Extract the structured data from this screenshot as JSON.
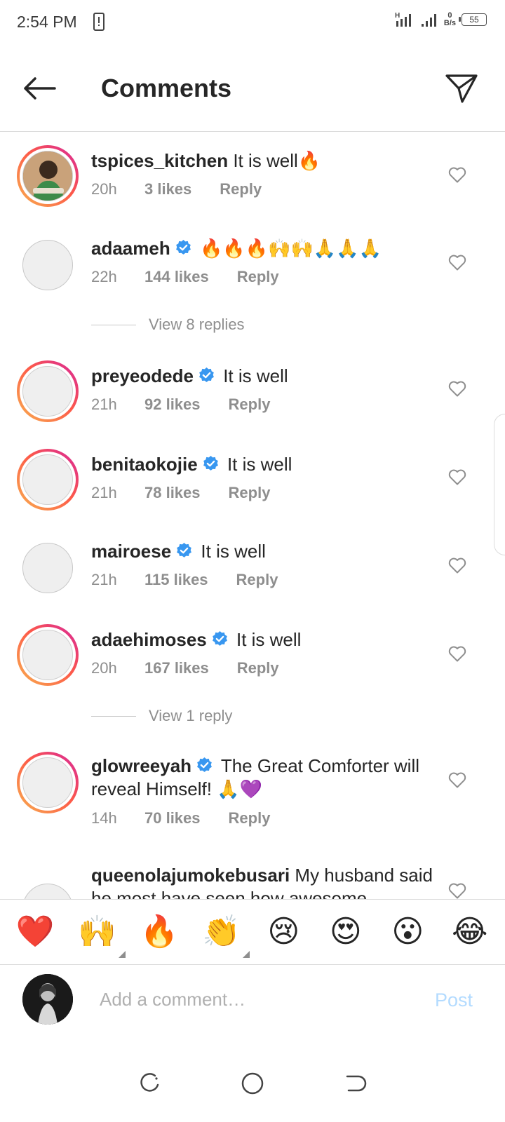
{
  "status_bar": {
    "time": "2:54 PM",
    "network_speed_value": "0",
    "network_speed_unit": "B/s",
    "battery": "55",
    "signal_label": "H"
  },
  "header": {
    "title": "Comments"
  },
  "comments": [
    {
      "username": "tspices_kitchen",
      "verified": false,
      "text": "It is well🔥",
      "time": "20h",
      "likes": "3 likes",
      "reply": "Reply"
    },
    {
      "username": "adaameh",
      "verified": true,
      "text": "🔥🔥🔥🙌🙌🙏🙏🙏",
      "time": "22h",
      "likes": "144 likes",
      "reply": "Reply"
    },
    {
      "username": "preyeodede",
      "verified": true,
      "text": "It is well",
      "time": "21h",
      "likes": "92 likes",
      "reply": "Reply"
    },
    {
      "username": "benitaokojie",
      "verified": true,
      "text": "It is well",
      "time": "21h",
      "likes": "78 likes",
      "reply": "Reply"
    },
    {
      "username": "mairoese",
      "verified": true,
      "text": "It is well",
      "time": "21h",
      "likes": "115 likes",
      "reply": "Reply"
    },
    {
      "username": "adaehimoses",
      "verified": true,
      "text": "It is well",
      "time": "20h",
      "likes": "167 likes",
      "reply": "Reply"
    },
    {
      "username": "glowreeyah",
      "verified": true,
      "text": "The Great Comforter will reveal Himself! 🙏💜",
      "time": "14h",
      "likes": "70 likes",
      "reply": "Reply"
    },
    {
      "username": "queenolajumokebusari",
      "verified": false,
      "text": "My husband said he most have seen how awesome"
    }
  ],
  "view_replies": [
    "View 8 replies",
    "View 1 reply"
  ],
  "quick_emojis": [
    "❤️",
    "🙌",
    "🔥",
    "👏",
    "😢",
    "😍",
    "😮",
    "😂"
  ],
  "composer": {
    "placeholder": "Add a comment…",
    "post_label": "Post"
  },
  "colors": {
    "verified": "#3897f0",
    "muted": "#8e8e8e",
    "post_disabled": "#b3dbff"
  }
}
